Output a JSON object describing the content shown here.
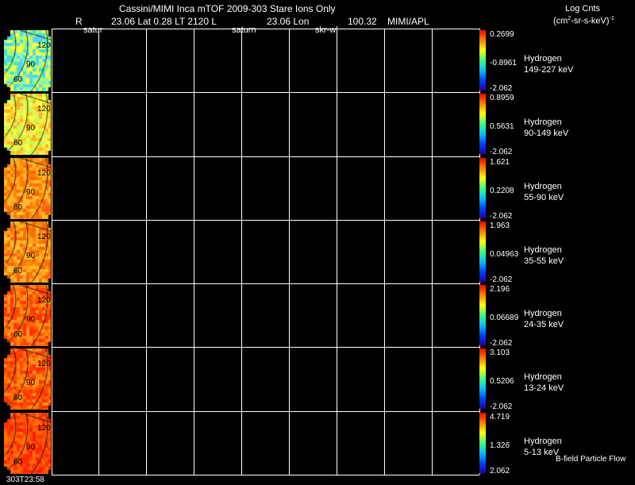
{
  "header": {
    "title": "Cassini/MIMI Inca mTOF  2009-303   Stare    Ions Only",
    "r_label": "R",
    "coords": "23.06 Lat 0.28 LT 2120 L",
    "lon": "23.06 Lon",
    "value": "100.32",
    "org": "MIMI/APL",
    "sub1": "satur",
    "sub2": "saturn",
    "sub3": "skr-wl"
  },
  "units": {
    "line1": "Log Cnts",
    "line2": "(cm",
    "sup": "2",
    "line2b": "-sr-s-keV)",
    "sup2": "-1"
  },
  "panels": [
    {
      "species": "Hydrogen",
      "energy": "149-227 keV",
      "max": "0.2699",
      "mid": "-0.8961",
      "min": "-2.062",
      "bg": "cyan"
    },
    {
      "species": "Hydrogen",
      "energy": "90-149 keV",
      "max": "0.8959",
      "mid": "0.5631",
      "min": "-2.062",
      "bg": "yellow"
    },
    {
      "species": "Hydrogen",
      "energy": "55-90 keV",
      "max": "1.621",
      "mid": "0.2208",
      "min": "-2.062",
      "bg": "orange"
    },
    {
      "species": "Hydrogen",
      "energy": "35-55 keV",
      "max": "1.963",
      "mid": "0.04963",
      "min": "-2.062",
      "bg": "orange"
    },
    {
      "species": "Hydrogen",
      "energy": "24-35 keV",
      "max": "2.196",
      "mid": "0.06689",
      "min": "-2.062",
      "bg": "redorange"
    },
    {
      "species": "Hydrogen",
      "energy": "13-24 keV",
      "max": "3.103",
      "mid": "0.5206",
      "min": "-2.062",
      "bg": "redorange"
    },
    {
      "species": "Hydrogen",
      "energy": "5-13 keV",
      "max": "4.719",
      "mid": "1.326",
      "min": "2.062",
      "bg": "red"
    }
  ],
  "thumb_labels": [
    "120",
    "90",
    "60"
  ],
  "footer": {
    "timestamp": "303T23:58",
    "note": "B-field Particle Flow"
  },
  "colors": {
    "background": "#000000",
    "grid": "#ffffff",
    "contour": "#000000"
  },
  "chart_data": {
    "type": "heatmap",
    "title": "Cassini/MIMI Inca mTOF  2009-303   Stare    Ions Only",
    "panels": 7,
    "grid": true,
    "colorbar_scale": "log",
    "series": [
      {
        "name": "149-227 keV",
        "range": [
          -2.062,
          0.2699
        ]
      },
      {
        "name": "90-149 keV",
        "range": [
          -2.062,
          0.8959
        ]
      },
      {
        "name": "55-90 keV",
        "range": [
          -2.062,
          1.621
        ]
      },
      {
        "name": "35-55 keV",
        "range": [
          -2.062,
          1.963
        ]
      },
      {
        "name": "24-35 keV",
        "range": [
          -2.062,
          2.196
        ]
      },
      {
        "name": "13-24 keV",
        "range": [
          -2.062,
          3.103
        ]
      },
      {
        "name": "5-13 keV",
        "range": [
          2.062,
          4.719
        ]
      }
    ]
  }
}
